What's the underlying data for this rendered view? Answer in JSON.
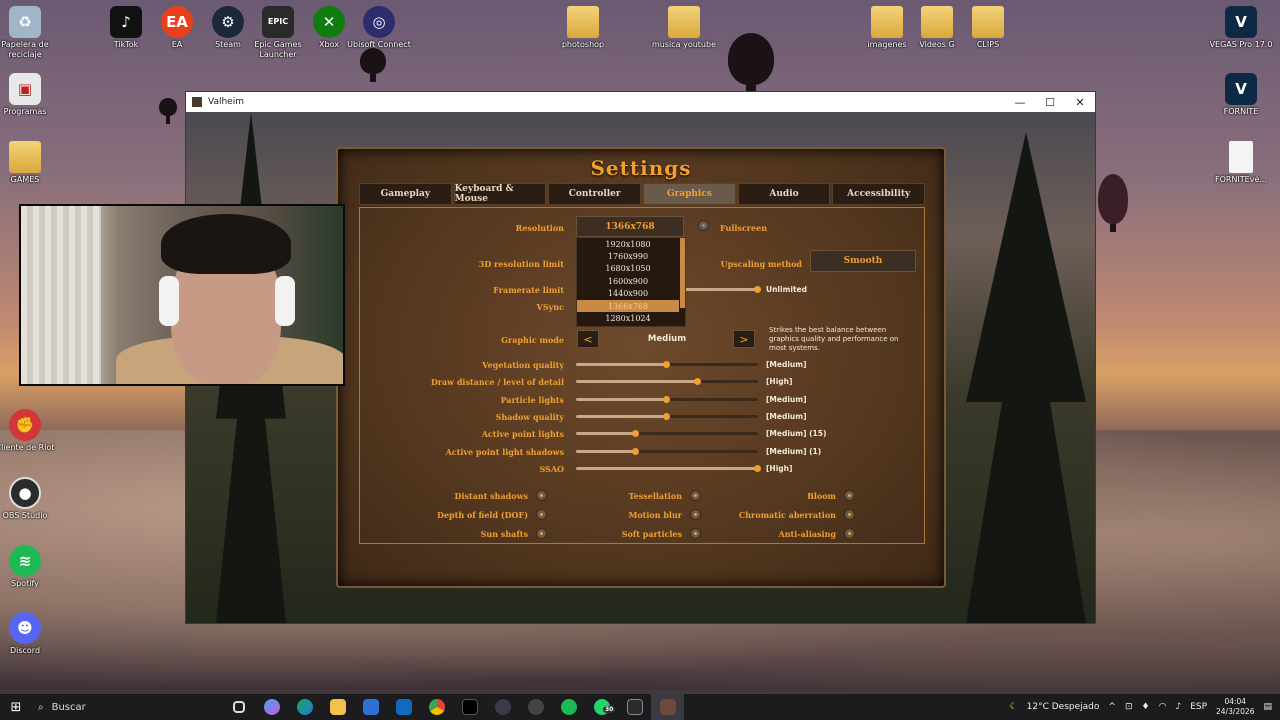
{
  "desktop": {
    "icons": [
      {
        "label": "Papelera de reciclaje",
        "icon": "recycle-bin-icon"
      },
      {
        "label": "TikTok",
        "icon": "tiktok-icon"
      },
      {
        "label": "EA",
        "icon": "ea-icon"
      },
      {
        "label": "Steam",
        "icon": "steam-icon"
      },
      {
        "label": "Epic Games Launcher",
        "icon": "epic-games-icon"
      },
      {
        "label": "Xbox",
        "icon": "xbox-icon"
      },
      {
        "label": "Ubisoft Connect",
        "icon": "ubisoft-icon"
      },
      {
        "label": "photoshop",
        "icon": "folder-icon"
      },
      {
        "label": "musica youtube",
        "icon": "folder-icon"
      },
      {
        "label": "imagenes",
        "icon": "folder-icon"
      },
      {
        "label": "Videos G",
        "icon": "folder-icon"
      },
      {
        "label": "CLIPS",
        "icon": "folder-icon"
      },
      {
        "label": "VEGAS Pro 17.0",
        "icon": "vegas-icon"
      },
      {
        "label": "FORNITE",
        "icon": "vegas-icon"
      },
      {
        "label": "FORNITEvé...",
        "icon": "file-icon"
      },
      {
        "label": "Programas",
        "icon": "programs-icon"
      },
      {
        "label": "GAMES",
        "icon": "folder-icon"
      },
      {
        "label": "Cliente de Riot",
        "icon": "riot-icon"
      },
      {
        "label": "OBS Studio",
        "icon": "obs-icon"
      },
      {
        "label": "Spotify",
        "icon": "spotify-icon"
      },
      {
        "label": "Discord",
        "icon": "discord-icon"
      }
    ]
  },
  "window": {
    "title": "Valheim",
    "minimize": "—",
    "maximize": "☐",
    "close": "✕"
  },
  "settings": {
    "title": "Settings",
    "tabs": [
      {
        "label": "Gameplay",
        "active": false
      },
      {
        "label": "Keyboard & Mouse",
        "active": false
      },
      {
        "label": "Controller",
        "active": false
      },
      {
        "label": "Graphics",
        "active": true
      },
      {
        "label": "Audio",
        "active": false
      },
      {
        "label": "Accessibility",
        "active": false
      }
    ],
    "resolution": {
      "label": "Resolution",
      "value": "1366x768",
      "options": [
        "1920x1080",
        "1760x990",
        "1680x1050",
        "1600x900",
        "1440x900",
        "1366x768",
        "1280x1024"
      ],
      "selected_index": 5
    },
    "fullscreen": {
      "label": "Fullscreen",
      "checked": false
    },
    "resolution_limit_label": "3D resolution limit",
    "upscaling": {
      "label": "Upscaling method",
      "value": "Smooth"
    },
    "framerate": {
      "label": "Framerate limit",
      "value": "Unlimited",
      "level": 1.0
    },
    "vsync_label": "VSync",
    "graphic_mode": {
      "label": "Graphic mode",
      "value": "Medium",
      "prev": "<",
      "next": ">",
      "description": "Strikes the best balance between graphics quality and performance on most systems."
    },
    "sliders": [
      {
        "label": "Vegetation quality",
        "value": "[Medium]",
        "level": 0.5
      },
      {
        "label": "Draw distance / level of detail",
        "value": "[High]",
        "level": 0.67
      },
      {
        "label": "Particle lights",
        "value": "[Medium]",
        "level": 0.5
      },
      {
        "label": "Shadow quality",
        "value": "[Medium]",
        "level": 0.5
      },
      {
        "label": "Active point lights",
        "value": "[Medium] (15)",
        "level": 0.33
      },
      {
        "label": "Active point light shadows",
        "value": "[Medium] (1)",
        "level": 0.33
      },
      {
        "label": "SSAO",
        "value": "[High]",
        "level": 1.0
      }
    ],
    "toggles": [
      {
        "label": "Distant shadows",
        "on": true
      },
      {
        "label": "Tessellation",
        "on": true
      },
      {
        "label": "Bloom",
        "on": true
      },
      {
        "label": "Depth of field (DOF)",
        "on": true
      },
      {
        "label": "Motion blur",
        "on": true
      },
      {
        "label": "Chromatic aberration",
        "on": true
      },
      {
        "label": "Sun shafts",
        "on": true
      },
      {
        "label": "Soft particles",
        "on": true
      },
      {
        "label": "Anti-aliasing",
        "on": true
      }
    ]
  },
  "taskbar": {
    "search_placeholder": "Buscar",
    "whatsapp_badge": "30",
    "weather": "12°C  Despejado",
    "language": "ESP",
    "time": "04:04",
    "date": "24/3/2026"
  },
  "colors": {
    "accent": "#f0a030",
    "panel": "#553820",
    "text_light": "#f3ead8"
  }
}
